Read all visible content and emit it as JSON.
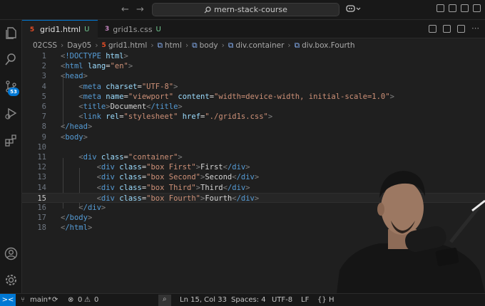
{
  "titlebar": {
    "back": "←",
    "forward": "→",
    "search_text": "mern-stack-course"
  },
  "activity": {
    "scm_badge": "53"
  },
  "tabs": [
    {
      "label": "grid1.html",
      "status": "U",
      "icon": "html-file-icon"
    },
    {
      "label": "grid1s.css",
      "status": "U",
      "icon": "css-file-icon"
    }
  ],
  "breadcrumb": [
    "02CSS",
    "Day05",
    "grid1.html",
    "html",
    "body",
    "div.container",
    "div.box.Fourth"
  ],
  "editor": {
    "current_line": 15,
    "lines": [
      {
        "n": "1",
        "text": "<!DOCTYPE html>"
      },
      {
        "n": "2",
        "text": "<html lang=\"en\">"
      },
      {
        "n": "3",
        "text": "<head>"
      },
      {
        "n": "4",
        "text": "    <meta charset=\"UTF-8\">"
      },
      {
        "n": "5",
        "text": "    <meta name=\"viewport\" content=\"width=device-width, initial-scale=1.0\">"
      },
      {
        "n": "6",
        "text": "    <title>Document</title>"
      },
      {
        "n": "7",
        "text": "    <link rel=\"stylesheet\" href=\"./grid1s.css\">"
      },
      {
        "n": "8",
        "text": "</head>"
      },
      {
        "n": "9",
        "text": "<body>"
      },
      {
        "n": "10",
        "text": ""
      },
      {
        "n": "11",
        "text": "    <div class=\"container\">"
      },
      {
        "n": "12",
        "text": "        <div class=\"box First\">First</div>"
      },
      {
        "n": "13",
        "text": "        <div class=\"box Second\">Second</div>"
      },
      {
        "n": "14",
        "text": "        <div class=\"box Third\">Third</div>"
      },
      {
        "n": "15",
        "text": "        <div class=\"box Fourth\">Fourth</div>"
      },
      {
        "n": "16",
        "text": "    </div>"
      },
      {
        "n": "17",
        "text": "</body>"
      },
      {
        "n": "18",
        "text": "</html>"
      }
    ]
  },
  "statusbar": {
    "remote": "><",
    "branch": "main*",
    "problems": "0",
    "warnings": "0",
    "cursor": "Ln 15, Col 33",
    "spaces": "Spaces: 4",
    "encoding": "UTF-8",
    "eol": "LF",
    "language": "H"
  },
  "colors": {
    "accent": "#0078d4",
    "tag": "#569cd6",
    "attr": "#9cdcfe",
    "string": "#ce9178",
    "untracked": "#73c991"
  }
}
